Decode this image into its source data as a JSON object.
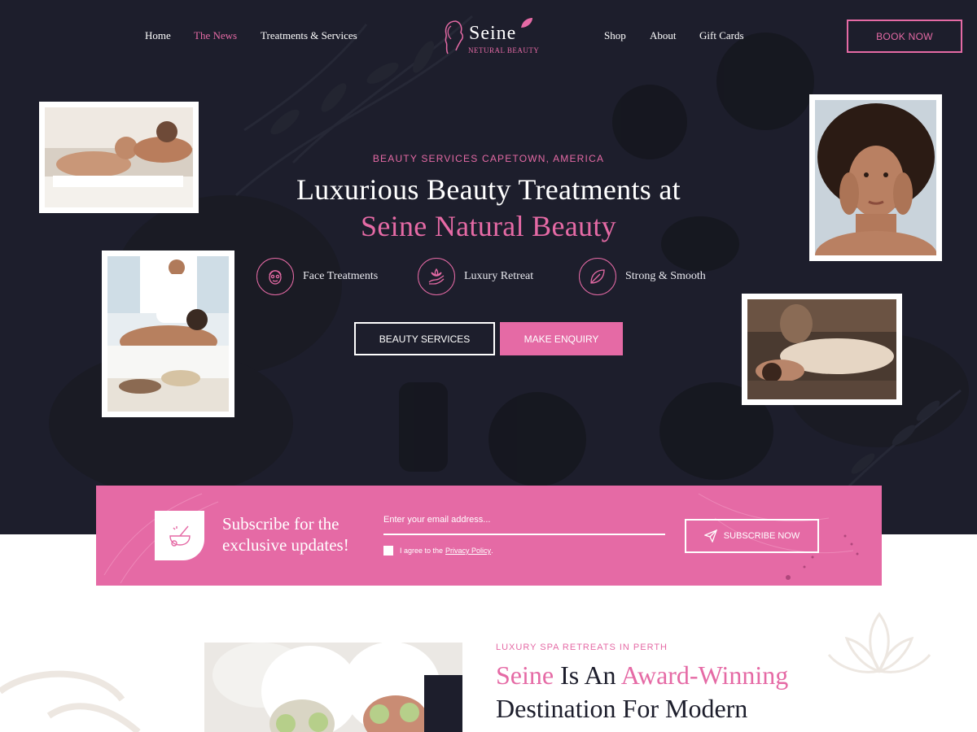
{
  "nav": {
    "left": [
      "Home",
      "The News",
      "Treatments & Services"
    ],
    "right": [
      "Shop",
      "About",
      "Gift Cards"
    ],
    "active": "The News",
    "book_label": "BOOK NOW"
  },
  "logo": {
    "name": "Seine",
    "tagline": "NETURAL BEAUTY"
  },
  "hero": {
    "eyebrow": "BEAUTY SERVICES CAPETOWN, AMERICA",
    "title_line1": "Luxurious Beauty Treatments at",
    "title_line2": "Seine Natural Beauty",
    "features": [
      {
        "label": "Face Treatments",
        "icon": "face-mask-icon"
      },
      {
        "label": "Luxury Retreat",
        "icon": "hand-lotus-icon"
      },
      {
        "label": "Strong & Smooth",
        "icon": "leaf-icon"
      }
    ],
    "btn_services": "BEAUTY SERVICES",
    "btn_enquiry": "MAKE ENQUIRY"
  },
  "subscribe": {
    "title": "Subscribe for the exclusive updates!",
    "email_placeholder": "Enter your email address...",
    "agree_prefix": "I agree to the",
    "privacy_link": "Privacy Policy",
    "agree_suffix": ".",
    "button": "SUBSCRIBE NOW",
    "icon": "mortar-pestle-icon"
  },
  "about": {
    "kicker": "LUXURY SPA RETREATS IN PERTH",
    "title_part1": "Seine",
    "title_part2": " Is An ",
    "title_part3": "Award-Winning",
    "title_line2": "Destination For Modern"
  },
  "colors": {
    "accent": "#e56aa5",
    "dark": "#1d1e2c",
    "white": "#ffffff"
  }
}
